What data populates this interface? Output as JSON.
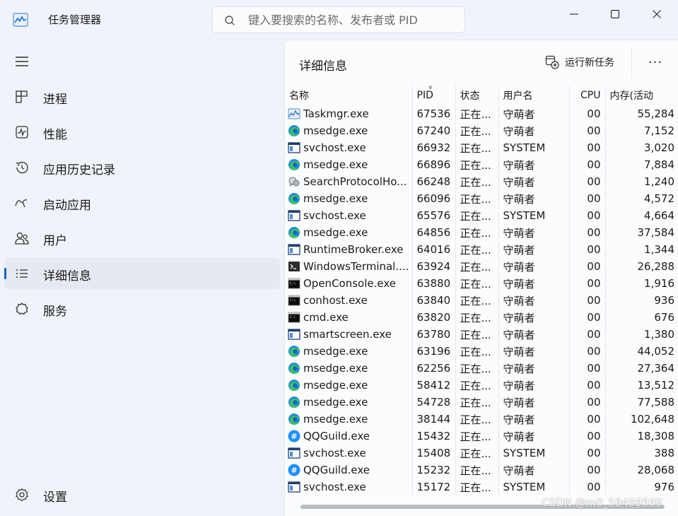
{
  "app": {
    "title": "任务管理器"
  },
  "search": {
    "placeholder": "键入要搜索的名称、发布者或 PID"
  },
  "sidebar": {
    "items": [
      {
        "label": "进程",
        "icon": "processes-icon"
      },
      {
        "label": "性能",
        "icon": "performance-icon"
      },
      {
        "label": "应用历史记录",
        "icon": "history-icon"
      },
      {
        "label": "启动应用",
        "icon": "startup-icon"
      },
      {
        "label": "用户",
        "icon": "users-icon"
      },
      {
        "label": "详细信息",
        "icon": "details-icon",
        "active": true
      },
      {
        "label": "服务",
        "icon": "services-icon"
      }
    ],
    "settings_label": "设置"
  },
  "main": {
    "title": "详细信息",
    "run_task_label": "运行新任务",
    "more_label": "···"
  },
  "table": {
    "headers": {
      "name": "名称",
      "pid": "PID",
      "status": "状态",
      "user": "用户名",
      "cpu": "CPU",
      "memory": "内存(活动"
    },
    "rows": [
      {
        "icon": "taskmgr",
        "name": "Taskmgr.exe",
        "pid": "67536",
        "status": "正在...",
        "user": "守萌者",
        "cpu": "00",
        "memory": "55,284"
      },
      {
        "icon": "edge",
        "name": "msedge.exe",
        "pid": "67240",
        "status": "正在...",
        "user": "守萌者",
        "cpu": "00",
        "memory": "7,152"
      },
      {
        "icon": "window",
        "name": "svchost.exe",
        "pid": "66932",
        "status": "正在...",
        "user": "SYSTEM",
        "cpu": "00",
        "memory": "3,020"
      },
      {
        "icon": "edge",
        "name": "msedge.exe",
        "pid": "66896",
        "status": "正在...",
        "user": "守萌者",
        "cpu": "00",
        "memory": "7,884"
      },
      {
        "icon": "search",
        "name": "SearchProtocolHo...",
        "pid": "66248",
        "status": "正在...",
        "user": "守萌者",
        "cpu": "00",
        "memory": "1,240"
      },
      {
        "icon": "edge",
        "name": "msedge.exe",
        "pid": "66096",
        "status": "正在...",
        "user": "守萌者",
        "cpu": "00",
        "memory": "4,572"
      },
      {
        "icon": "window",
        "name": "svchost.exe",
        "pid": "65576",
        "status": "正在...",
        "user": "SYSTEM",
        "cpu": "00",
        "memory": "4,664"
      },
      {
        "icon": "edge",
        "name": "msedge.exe",
        "pid": "64856",
        "status": "正在...",
        "user": "守萌者",
        "cpu": "00",
        "memory": "37,584"
      },
      {
        "icon": "window",
        "name": "RuntimeBroker.exe",
        "pid": "64016",
        "status": "正在...",
        "user": "守萌者",
        "cpu": "00",
        "memory": "1,344"
      },
      {
        "icon": "terminal",
        "name": "WindowsTerminal....",
        "pid": "63924",
        "status": "正在...",
        "user": "守萌者",
        "cpu": "00",
        "memory": "26,288"
      },
      {
        "icon": "console",
        "name": "OpenConsole.exe",
        "pid": "63880",
        "status": "正在...",
        "user": "守萌者",
        "cpu": "00",
        "memory": "1,916"
      },
      {
        "icon": "console",
        "name": "conhost.exe",
        "pid": "63840",
        "status": "正在...",
        "user": "守萌者",
        "cpu": "00",
        "memory": "936"
      },
      {
        "icon": "console",
        "name": "cmd.exe",
        "pid": "63820",
        "status": "正在...",
        "user": "守萌者",
        "cpu": "00",
        "memory": "676"
      },
      {
        "icon": "window",
        "name": "smartscreen.exe",
        "pid": "63780",
        "status": "正在...",
        "user": "守萌者",
        "cpu": "00",
        "memory": "1,380"
      },
      {
        "icon": "edge",
        "name": "msedge.exe",
        "pid": "63196",
        "status": "正在...",
        "user": "守萌者",
        "cpu": "00",
        "memory": "44,052"
      },
      {
        "icon": "edge",
        "name": "msedge.exe",
        "pid": "62256",
        "status": "正在...",
        "user": "守萌者",
        "cpu": "00",
        "memory": "27,364"
      },
      {
        "icon": "edge",
        "name": "msedge.exe",
        "pid": "58412",
        "status": "正在...",
        "user": "守萌者",
        "cpu": "00",
        "memory": "13,512"
      },
      {
        "icon": "edge",
        "name": "msedge.exe",
        "pid": "54728",
        "status": "正在...",
        "user": "守萌者",
        "cpu": "00",
        "memory": "77,588"
      },
      {
        "icon": "edge",
        "name": "msedge.exe",
        "pid": "38144",
        "status": "正在...",
        "user": "守萌者",
        "cpu": "00",
        "memory": "102,648"
      },
      {
        "icon": "qqguild",
        "name": "QQGuild.exe",
        "pid": "15432",
        "status": "正在...",
        "user": "守萌者",
        "cpu": "00",
        "memory": "18,308"
      },
      {
        "icon": "window",
        "name": "svchost.exe",
        "pid": "15408",
        "status": "正在...",
        "user": "SYSTEM",
        "cpu": "00",
        "memory": "388"
      },
      {
        "icon": "qqguild",
        "name": "QQGuild.exe",
        "pid": "15232",
        "status": "正在...",
        "user": "守萌者",
        "cpu": "00",
        "memory": "28,068"
      },
      {
        "icon": "window",
        "name": "svchost.exe",
        "pid": "15172",
        "status": "正在...",
        "user": "SYSTEM",
        "cpu": "00",
        "memory": "976"
      }
    ]
  },
  "watermark": "CSDN @m0_59499599",
  "colors": {
    "accent": "#0067c0",
    "edge_blue": "#1f8bd8",
    "edge_green": "#3cc26a",
    "qq_blue": "#1e90ff"
  }
}
